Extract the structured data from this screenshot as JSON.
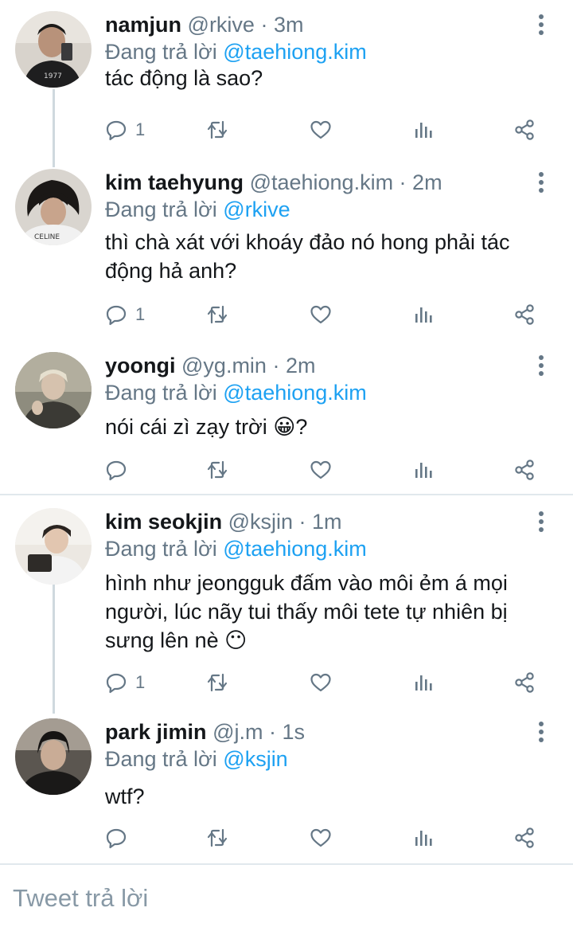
{
  "colors": {
    "accent": "#1da1f2",
    "muted": "#657786",
    "text": "#14171a",
    "line": "#cfd9de"
  },
  "icons": {
    "reply": "comment-icon",
    "retweet": "retweet-icon",
    "like": "heart-icon",
    "stats": "bar-chart-icon",
    "share": "share-icon",
    "more": "more-vertical-icon"
  },
  "tweets": [
    {
      "name": "namjun",
      "handle": "@rkive · 3m",
      "replying_prefix": "Đang trả lời",
      "replying_to": "@taehiong.kim",
      "text": "tác động là sao?",
      "reply_count": "1"
    },
    {
      "name": "kim taehyung",
      "handle": "@taehiong.kim · 2m",
      "replying_prefix": "Đang trả lời",
      "replying_to": "@rkive",
      "text": "thì chà xát với khoáy đảo nó hong phải tác động hả anh?",
      "reply_count": "1"
    },
    {
      "name": "yoongi",
      "handle": "@yg.min · 2m",
      "replying_prefix": "Đang trả lời",
      "replying_to": "@taehiong.kim",
      "text": "nói cái zì zạy trời 😀?",
      "reply_count": ""
    },
    {
      "name": "kim seokjin",
      "handle": "@ksjin · 1m",
      "replying_prefix": "Đang trả lời",
      "replying_to": "@taehiong.kim",
      "text": "hình như jeongguk đấm vào môi ẻm á mọi người, lúc nãy tui thấy môi tete tự nhiên bị sưng lên nè 😶",
      "reply_count": "1"
    },
    {
      "name": "park jimin",
      "handle": "@j.m · 1s",
      "replying_prefix": "Đang trả lời",
      "replying_to": "@ksjin",
      "text": "wtf?",
      "reply_count": ""
    }
  ],
  "composer": {
    "placeholder": "Tweet trả lời"
  }
}
